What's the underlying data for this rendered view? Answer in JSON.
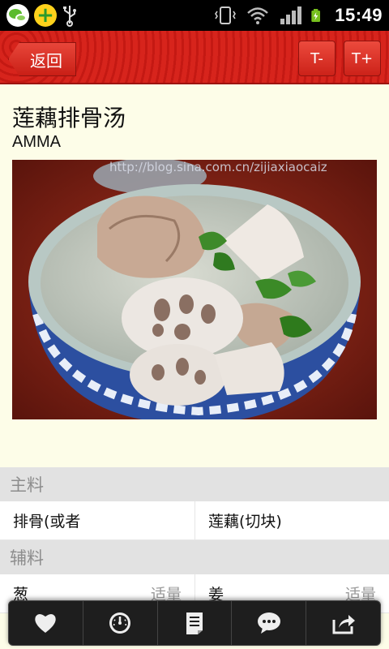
{
  "status_bar": {
    "time": "15:49",
    "left_icons": [
      "wechat-icon",
      "plus-app-icon",
      "usb-icon"
    ],
    "right_icons": [
      "vibrate-icon",
      "wifi-icon",
      "signal-icon",
      "battery-charging-icon"
    ]
  },
  "header": {
    "back_label": "返回",
    "font_smaller_label": "T-",
    "font_larger_label": "T+"
  },
  "recipe": {
    "title": "莲藕排骨汤",
    "author": "AMMA",
    "watermark": "http://blog.sina.com.cn/zijiaxiaocaiz"
  },
  "ingredients": {
    "main_label": "主料",
    "main_items": [
      {
        "name": "排骨(或者",
        "qty": ""
      },
      {
        "name": "莲藕(切块)",
        "qty": ""
      }
    ],
    "aux_label": "辅料",
    "aux_items": [
      {
        "name": "葱",
        "qty": "适量"
      },
      {
        "name": "姜",
        "qty": "适量"
      }
    ]
  },
  "toolbar": {
    "items": [
      "favorite-icon",
      "timer-icon",
      "notes-icon",
      "comment-icon",
      "share-icon"
    ]
  },
  "colors": {
    "header_red": "#cf1f17",
    "page_background": "#fdfde8",
    "section_gray": "#e2e2e2"
  }
}
